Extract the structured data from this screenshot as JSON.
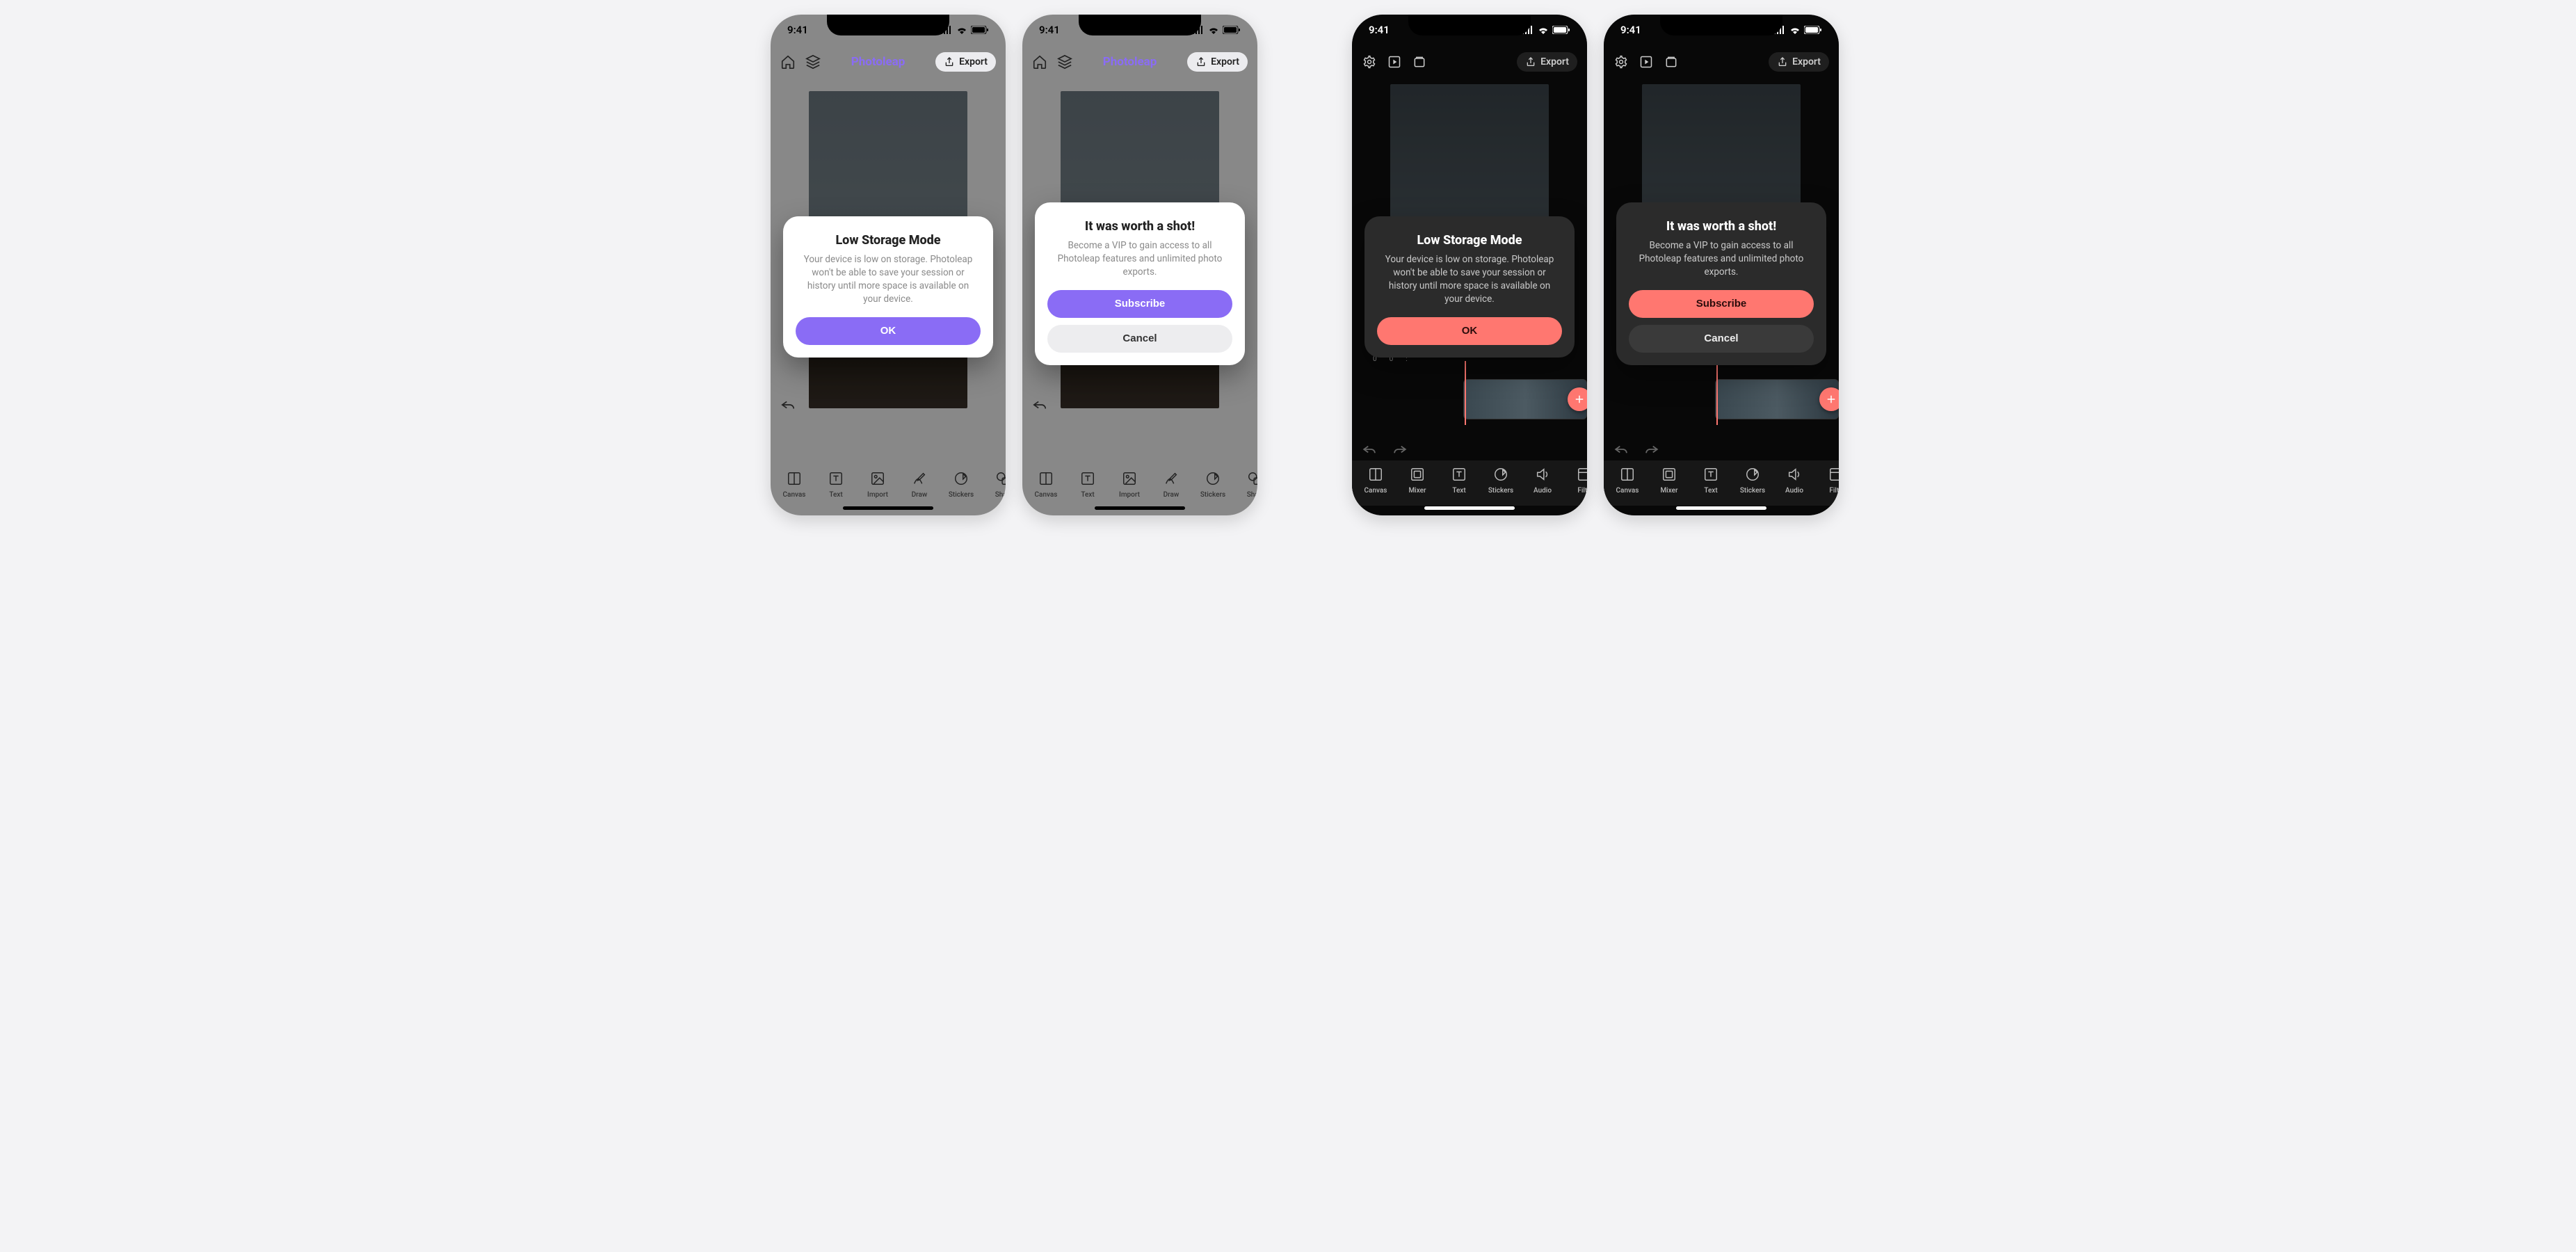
{
  "status": {
    "time": "9:41"
  },
  "app_light": {
    "brand": "Photoleap",
    "export_label": "Export"
  },
  "app_dark": {
    "export_label": "Export",
    "timeline_marks": "00:"
  },
  "tools_light": [
    {
      "label": "Canvas",
      "icon": "canvas"
    },
    {
      "label": "Text",
      "icon": "text"
    },
    {
      "label": "Import",
      "icon": "import"
    },
    {
      "label": "Draw",
      "icon": "draw"
    },
    {
      "label": "Stickers",
      "icon": "stickers"
    },
    {
      "label": "Shap",
      "icon": "shapes"
    }
  ],
  "tools_dark": [
    {
      "label": "Canvas",
      "icon": "canvas"
    },
    {
      "label": "Mixer",
      "icon": "mixer"
    },
    {
      "label": "Text",
      "icon": "text"
    },
    {
      "label": "Stickers",
      "icon": "stickers"
    },
    {
      "label": "Audio",
      "icon": "audio"
    },
    {
      "label": "Filte",
      "icon": "filters"
    }
  ],
  "alerts": {
    "low_storage": {
      "title": "Low Storage Mode",
      "body": "Your device is low on storage. Photoleap won't be able to save your session or history until more space is available on your device.",
      "primary": "OK"
    },
    "subscribe": {
      "title": "It was worth a shot!",
      "body": "Become a VIP to gain access to all Photoleap features and unlimited photo exports.",
      "primary": "Subscribe",
      "secondary": "Cancel"
    }
  }
}
